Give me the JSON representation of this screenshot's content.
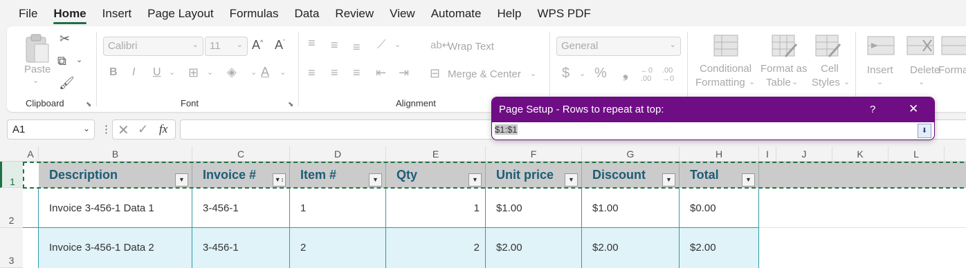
{
  "menu": {
    "items": [
      "File",
      "Home",
      "Insert",
      "Page Layout",
      "Formulas",
      "Data",
      "Review",
      "View",
      "Automate",
      "Help",
      "WPS PDF"
    ],
    "active": "Home"
  },
  "ribbon": {
    "clipboard": {
      "label": "Clipboard",
      "paste": "Paste"
    },
    "font": {
      "label": "Font",
      "name": "Calibri",
      "size": "11",
      "grow": "A^",
      "shrink": "Aˇ",
      "bold": "B",
      "italic": "I",
      "underline": "U",
      "font_color": "A"
    },
    "alignment": {
      "label": "Alignment",
      "wrap_text": "Wrap Text",
      "merge_center": "Merge & Center"
    },
    "number": {
      "format": "General",
      "currency": "$",
      "percent": "%",
      "comma": "❟",
      "inc_decimal": "←0 .00",
      "dec_decimal": ".00 →0"
    },
    "styles": {
      "conditional": [
        "Conditional",
        "Formatting"
      ],
      "format_table": [
        "Format as",
        "Table"
      ],
      "cell_styles": [
        "Cell",
        "Styles"
      ]
    },
    "cells": {
      "insert": "Insert",
      "delete": "Delete",
      "format": "Forma"
    }
  },
  "formula_bar": {
    "name_box": "A1",
    "fx": "fx",
    "value": ""
  },
  "columns": [
    "A",
    "B",
    "C",
    "D",
    "E",
    "F",
    "G",
    "H",
    "I",
    "J",
    "K",
    "L"
  ],
  "rows": [
    "1",
    "2",
    "3"
  ],
  "table": {
    "headers": [
      "Description",
      "Invoice #",
      "Item #",
      "Qty",
      "Unit price",
      "Discount",
      "Total"
    ],
    "rows": [
      [
        "Invoice 3-456-1 Data 1",
        "3-456-1",
        "1",
        "1",
        "$1.00",
        "$1.00",
        "$0.00"
      ],
      [
        "Invoice 3-456-1 Data 2",
        "3-456-1",
        "2",
        "2",
        "$2.00",
        "$2.00",
        "$2.00"
      ]
    ]
  },
  "dialog": {
    "title": "Page Setup - Rows to repeat at top:",
    "help": "?",
    "close": "✕",
    "value": "$1:$1"
  },
  "colors": {
    "accent": "#1e7145",
    "dialog_title": "#6f0d84",
    "table_header": "#cbcbcb",
    "band": "#dff3f8",
    "border": "#2e9aa7"
  }
}
